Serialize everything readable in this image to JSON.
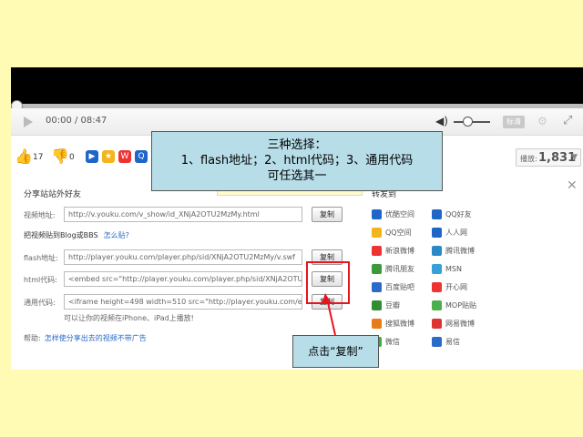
{
  "player": {
    "time_display": "00:00 / 08:47",
    "quality_label": "标清"
  },
  "actions": {
    "like_count": "17",
    "dislike_count": "0",
    "play_count_label": "播放:",
    "play_count_value": "1,831"
  },
  "share_panel": {
    "title": "分享站站外好友",
    "video_url_label": "视频地址:",
    "video_url_value": "http://v.youku.com/v_show/id_XNjA2OTU2MzMy.html",
    "embed_header": "把视频贴到Blog或BBS",
    "embed_help": "怎么贴?",
    "flash_label": "flash地址:",
    "flash_value": "http://player.youku.com/player.php/sid/XNjA2OTU2MzMy/v.swf",
    "html_label": "html代码:",
    "html_value": "<embed src=\"http://player.youku.com/player.php/sid/XNjA2OTU2",
    "generic_label": "通用代码:",
    "generic_value": "<iframe height=498 width=510 src=\"http://player.youku.com/emb",
    "copy_label": "复制",
    "ipad_note": "可以让你的视频在iPhone、iPad上播放!",
    "help_label": "帮助:",
    "help_link": "怎样使分享出去的视频不带广告"
  },
  "reprint": {
    "title": "转发到",
    "sites_left": [
      "优酷空间",
      "QQ空间",
      "新浪微博",
      "腾讯朋友",
      "百度贴吧",
      "豆瓣",
      "搜狐微博",
      "微信"
    ],
    "sites_right": [
      "QQ好友",
      "人人网",
      "腾讯微博",
      "MSN",
      "开心网",
      "MOP贴贴",
      "网易微博",
      "易信"
    ],
    "colors_left": [
      "#1f66c8",
      "#f2b51c",
      "#e33",
      "#3a9a3a",
      "#2a6ac8",
      "#2f8f2f",
      "#e87c1a",
      "#3aae3a"
    ],
    "colors_right": [
      "#1f66c8",
      "#1f66c8",
      "#2a8ac8",
      "#38a0d8",
      "#e33",
      "#4bb04b",
      "#d33",
      "#2a6ac8"
    ]
  },
  "annotations": {
    "top_line1": "三种选择：",
    "top_line2": "1、flash地址；2、html代码；3、通用代码",
    "top_line3": "可任选其一",
    "bottom": "点击“复制”",
    "accent": "#e8141e",
    "callout_bg": "#b7dde8",
    "slide_bg": "#fffbb5"
  }
}
